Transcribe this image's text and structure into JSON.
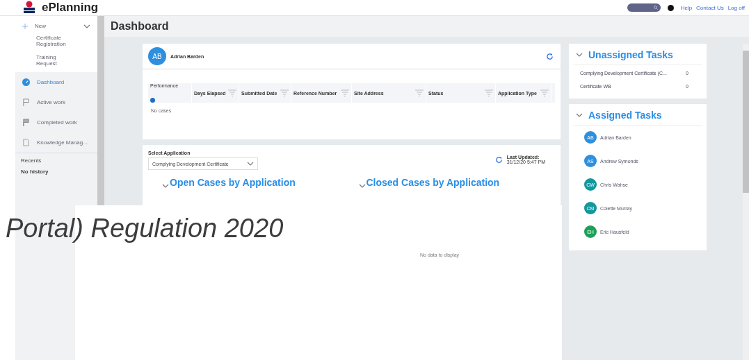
{
  "header": {
    "brand": "ePlanning",
    "links": [
      "Help",
      "Contact Us",
      "Log off"
    ]
  },
  "sidebar": {
    "new_button": {
      "label": "New",
      "expanded": true,
      "children": [
        "Certificate Registration",
        "Training Request"
      ]
    },
    "items": [
      {
        "label": "Dashboard",
        "selected": true
      },
      {
        "label": "Active work",
        "selected": false
      },
      {
        "label": "Completed work",
        "selected": false
      },
      {
        "label": "Knowledge Manag...",
        "selected": false
      }
    ],
    "recents_title": "Recents",
    "recents_empty": "No history"
  },
  "page_title": "Dashboard",
  "user_card": {
    "initials": "AB",
    "name": "Adrian Barden",
    "table": {
      "columns": [
        "Performance",
        "Days Elapsed",
        "Submitted Date",
        "Reference Number",
        "Site Address",
        "Status",
        "Application Type"
      ],
      "empty": "No cases"
    }
  },
  "charts_card": {
    "select_label": "Select Application",
    "select_value": "Complying Development Certificate",
    "last_updated_label": "Last Updated:",
    "last_updated": "31/12/20 5:47 PM",
    "sections": [
      "Open Cases by Application",
      "Closed Cases by Application"
    ],
    "empty": "No data to display"
  },
  "unassigned_tasks": {
    "title": "Unassigned Tasks",
    "items": [
      {
        "label": "Complying Development Certificate (C...",
        "count": "0"
      },
      {
        "label": "Certificate WB",
        "count": "0"
      }
    ]
  },
  "assigned_tasks": {
    "title": "Assigned Tasks",
    "people": [
      {
        "initials": "AB",
        "name": "Adrian Barden",
        "color": "#2d8fdd"
      },
      {
        "initials": "AS",
        "name": "Andrew Symonds",
        "color": "#2d8fdd"
      },
      {
        "initials": "CW",
        "name": "Chris Wahse",
        "color": "#12989c"
      },
      {
        "initials": "CM",
        "name": "Colette Murray",
        "color": "#12989c"
      },
      {
        "initials": "EH",
        "name": "Eric Hausfeld",
        "color": "#1ba157"
      }
    ]
  },
  "overlay_caption": "Portal) Regulation 2020"
}
